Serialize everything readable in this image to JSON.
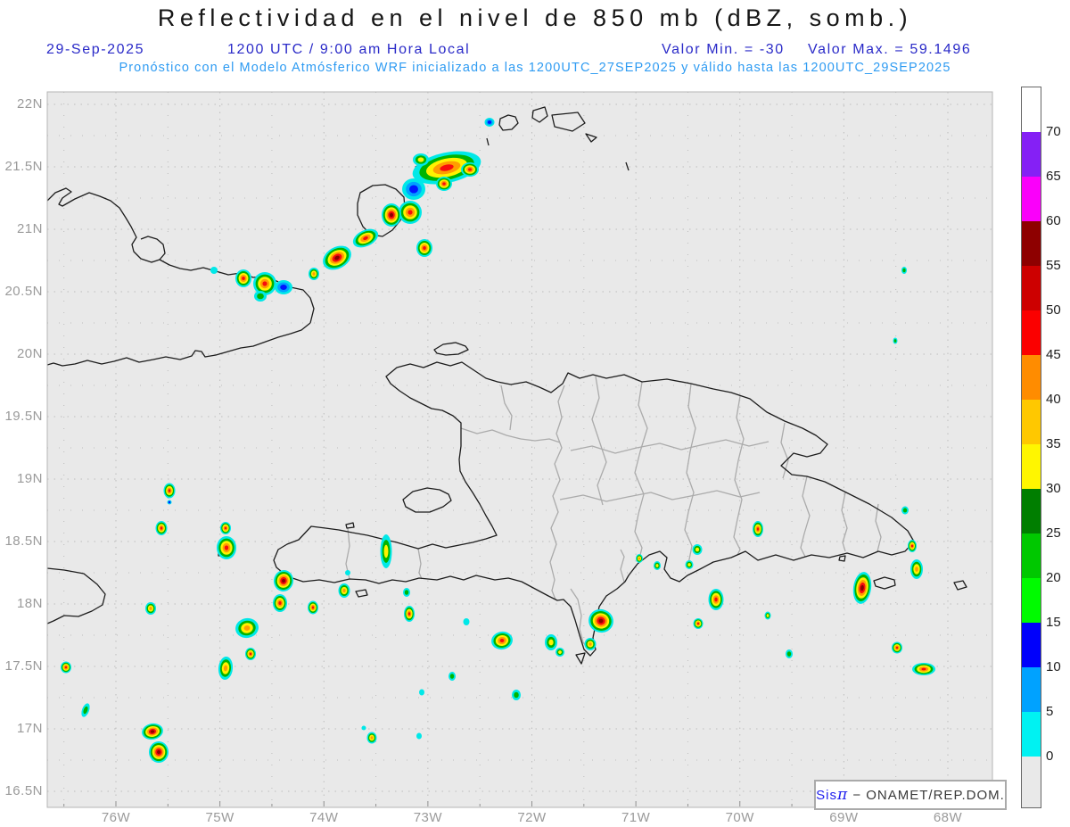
{
  "header": {
    "title": "Reflectividad en el nivel de 850 mb (dBZ, somb.)",
    "date": "29-Sep-2025",
    "time_line": "1200 UTC / 9:00 am Hora Local",
    "valor_min": "Valor Min. = -30",
    "valor_max": "Valor Max. = 59.1496",
    "forecast_line": "Pronóstico con el Modelo Atmósferico WRF inicializado a las 1200UTC_27SEP2025 y válido hasta las 1200UTC_29SEP2025"
  },
  "branding": {
    "prefix": "Sis",
    "pi": "π",
    "suffix": " − ONAMET/REP.DOM."
  },
  "axes": {
    "lat_labels": [
      "22N",
      "21.5N",
      "21N",
      "20.5N",
      "20N",
      "19.5N",
      "19N",
      "18.5N",
      "18N",
      "17.5N",
      "17N",
      "16.5N"
    ],
    "lon_labels": [
      "76W",
      "75W",
      "74W",
      "73W",
      "72W",
      "71W",
      "70W",
      "69W",
      "68W"
    ]
  },
  "colorbar": {
    "tick_labels": [
      "70",
      "65",
      "60",
      "55",
      "50",
      "45",
      "40",
      "35",
      "30",
      "25",
      "20",
      "15",
      "10",
      "5",
      "0"
    ],
    "segment_colors_top_to_bottom": [
      "#ffffff",
      "#8520f5",
      "#fa00fa",
      "#8e0000",
      "#cd0000",
      "#fb0000",
      "#ff8c00",
      "#ffc800",
      "#fff600",
      "#007e00",
      "#00c800",
      "#00fb00",
      "#0000fb",
      "#00a2ff",
      "#00f2f2",
      "#e9e9e9"
    ]
  },
  "colors": {
    "plot_bg": "#e9e9e9",
    "grid": "#bdbdbd",
    "coast": "#1c1c1c",
    "province": "#ababab",
    "header_blue": "#2a2ac8",
    "forecast_blue": "#2e9bf2",
    "axis_gray": "#9a9a9a"
  },
  "chart_data": {
    "type": "heatmap",
    "subtype": "geographic-reflectivity-map",
    "title": "Reflectividad en el nivel de 850 mb (dBZ, somb.)",
    "units": "dBZ",
    "level": "850 mb",
    "value_min": -30,
    "value_max": 59.1496,
    "model": "WRF",
    "init_time": "1200UTC_27SEP2025",
    "valid_time": "1200UTC_29SEP2025",
    "display_date": "29-Sep-2025",
    "display_time": "1200 UTC / 9:00 am Hora Local",
    "lon_axis_deg_west": [
      76,
      75,
      74,
      73,
      72,
      71,
      70,
      69,
      68
    ],
    "lat_axis_deg_north": [
      22,
      21.5,
      21,
      20.5,
      20,
      19.5,
      19,
      18.5,
      18,
      17.5,
      17,
      16.5
    ],
    "colorbar_levels": [
      0,
      5,
      10,
      15,
      20,
      25,
      30,
      35,
      40,
      45,
      50,
      55,
      60,
      65,
      70
    ],
    "legend_position": "right",
    "grid_on": true,
    "cells_note": "x,y in plot pixels (53-1113 maps 76.66W-67.57W; 103-905 maps 22.1N-16.36N); dbz = peak reflectivity of cell",
    "cells": {
      "fields": [
        "x",
        "y",
        "w",
        "h",
        "rot",
        "dbz"
      ],
      "points": [
        [
          501,
          188,
          78,
          34,
          -12,
          50
        ],
        [
          527,
          190,
          20,
          16,
          0,
          48
        ],
        [
          472,
          179,
          18,
          14,
          0,
          34
        ],
        [
          464,
          212,
          26,
          24,
          0,
          14
        ],
        [
          460,
          238,
          26,
          26,
          0,
          48
        ],
        [
          439,
          241,
          22,
          26,
          0,
          56
        ],
        [
          498,
          206,
          18,
          16,
          0,
          47
        ],
        [
          476,
          278,
          18,
          20,
          0,
          47
        ],
        [
          410,
          267,
          30,
          18,
          -25,
          48
        ],
        [
          378,
          289,
          34,
          24,
          -30,
          56
        ],
        [
          352,
          307,
          12,
          14,
          0,
          42
        ],
        [
          297,
          318,
          26,
          26,
          0,
          48
        ],
        [
          273,
          312,
          18,
          20,
          0,
          47
        ],
        [
          318,
          322,
          20,
          16,
          0,
          13
        ],
        [
          292,
          332,
          14,
          12,
          0,
          22
        ],
        [
          240,
          303,
          8,
          8,
          0,
          5
        ],
        [
          549,
          137,
          11,
          10,
          0,
          13
        ],
        [
          190,
          550,
          13,
          17,
          0,
          48
        ],
        [
          190,
          563,
          5,
          5,
          0,
          12
        ],
        [
          181,
          592,
          13,
          16,
          0,
          47
        ],
        [
          253,
          592,
          12,
          14,
          0,
          47
        ],
        [
          254,
          614,
          22,
          26,
          0,
          49
        ],
        [
          169,
          682,
          12,
          14,
          0,
          42
        ],
        [
          318,
          651,
          22,
          24,
          10,
          56
        ],
        [
          314,
          676,
          16,
          20,
          0,
          48
        ],
        [
          351,
          681,
          12,
          15,
          0,
          47
        ],
        [
          277,
          704,
          26,
          22,
          -10,
          42
        ],
        [
          281,
          733,
          12,
          14,
          0,
          48
        ],
        [
          253,
          749,
          16,
          26,
          5,
          43
        ],
        [
          74,
          748,
          12,
          13,
          0,
          47
        ],
        [
          96,
          796,
          8,
          16,
          20,
          22
        ],
        [
          171,
          820,
          24,
          18,
          -10,
          55
        ],
        [
          178,
          843,
          22,
          24,
          0,
          56
        ],
        [
          433,
          618,
          13,
          38,
          0,
          35
        ],
        [
          386,
          662,
          13,
          16,
          0,
          42
        ],
        [
          456,
          664,
          8,
          10,
          0,
          22
        ],
        [
          459,
          688,
          12,
          18,
          0,
          47
        ],
        [
          390,
          642,
          6,
          6,
          0,
          5
        ],
        [
          417,
          827,
          11,
          13,
          0,
          42
        ],
        [
          408,
          816,
          5,
          5,
          0,
          5
        ],
        [
          470,
          825,
          6,
          7,
          0,
          6
        ],
        [
          473,
          776,
          6,
          7,
          0,
          6
        ],
        [
          507,
          758,
          8,
          10,
          0,
          22
        ],
        [
          523,
          697,
          7,
          8,
          0,
          6
        ],
        [
          563,
          718,
          24,
          20,
          -10,
          49
        ],
        [
          618,
          720,
          14,
          18,
          0,
          35
        ],
        [
          628,
          731,
          10,
          10,
          40,
          34
        ],
        [
          579,
          779,
          10,
          12,
          0,
          22
        ],
        [
          674,
          696,
          28,
          26,
          15,
          56
        ],
        [
          662,
          722,
          13,
          14,
          0,
          42
        ],
        [
          717,
          626,
          8,
          10,
          0,
          41
        ],
        [
          737,
          634,
          8,
          10,
          0,
          34
        ],
        [
          782,
          616,
          11,
          12,
          0,
          35
        ],
        [
          773,
          633,
          9,
          10,
          0,
          34
        ],
        [
          803,
          672,
          17,
          24,
          0,
          48
        ],
        [
          783,
          699,
          11,
          12,
          0,
          47
        ],
        [
          850,
          593,
          12,
          18,
          0,
          48
        ],
        [
          861,
          690,
          7,
          9,
          0,
          34
        ],
        [
          885,
          733,
          8,
          10,
          0,
          22
        ],
        [
          967,
          659,
          20,
          36,
          8,
          55
        ],
        [
          1006,
          726,
          12,
          13,
          0,
          47
        ],
        [
          1036,
          750,
          26,
          14,
          0,
          48
        ],
        [
          1015,
          572,
          8,
          9,
          0,
          22
        ],
        [
          1023,
          612,
          10,
          14,
          0,
          47
        ],
        [
          1028,
          638,
          14,
          22,
          0,
          42
        ],
        [
          1014,
          303,
          6,
          8,
          0,
          20
        ],
        [
          1004,
          382,
          5,
          7,
          0,
          20
        ]
      ]
    },
    "geo": {
      "coastlines": [
        "M 53 225 L 62 216 L 74 211 L 80 215 L 70 222 L 66 229 L 70 231 L 84 223 L 100 216 L 112 220 L 124 225 L 134 233 L 141 244 L 147 254 L 153 266 L 148 274 L 150 282 L 158 290 L 170 294 L 179 291 L 185 284 L 183 274 L 176 268 L 166 265 L 158 268 M 179 291 L 190 297 L 202 301 L 214 303 L 228 300 L 242 304 L 256 308 L 270 306 L 284 311 L 298 309 L 312 316 L 326 322 L 340 325 L 348 334 L 352 346 L 348 362",
        "M 348 362 L 338 370 L 326 374 L 312 378 L 298 383 L 284 388 L 270 390 L 256 394 L 242 398 L 230 400 L 226 394 L 219 393 L 215 399 L 202 403 L 186 400 L 172 403 L 156 406 L 142 401 L 128 405 L 114 408 L 98 404 L 84 408 L 70 410 L 60 407 L 53 409",
        "M 53 637 L 72 639 L 94 643 L 109 655 L 118 666 L 115 678 L 103 685 L 88 691 L 72 690 L 60 696 L 53 699",
        "M 433 422 L 445 412 L 460 408 L 475 412 L 490 406 L 505 410 L 518 406 L 530 414 L 545 424 L 558 428 L 573 431 L 590 428 L 605 434 L 618 440 L 631 430 L 637 418 L 650 424 L 665 420 L 680 424 L 700 420 L 720 428 L 748 425 L 775 430 L 800 436 L 820 440 L 841 447 L 860 462 L 880 472 L 900 480 L 915 488 L 928 498 L 920 508 L 905 512 L 890 508 L 876 522 L 888 532 L 905 534 L 925 540 L 945 550 L 975 565 L 1000 580 L 1018 595 L 1025 607 L 1015 618 L 1000 622 L 985 618 L 968 625 L 950 620 L 930 625 L 910 622 L 890 628 L 870 622 L 850 628 L 836 618 L 820 625 L 800 630 L 785 638 L 771 645 L 762 652 L 752 648 L 745 638 L 748 625 L 740 618 L 728 622 L 715 632 L 705 645 L 701 652 L 692 660 L 680 668 L 672 680 L 668 700 L 665 715 L 668 728 L 662 735 L 655 728 L 650 712 L 645 695 L 640 680 L 632 672 L 625 673 L 615 668 L 600 660 L 585 652 L 570 648 L 555 650 L 534 645 L 520 650 L 505 646 L 490 650 L 470 648 L 455 652 L 440 650 L 425 654 L 410 650 L 392 649 L 375 653 L 358 650 L 340 652 L 322 646 L 310 636 L 307 628 L 312 616 L 322 610 L 335 605 L 349 590 L 365 592 L 380 594 L 395 597 L 412 600 L 428 604 L 445 608 L 462 613 L 469 615 L 485 610 L 500 614 L 515 611 L 530 608 L 545 604 L 557 600 L 552 590 L 545 578 L 538 565 L 530 552 L 522 540 L 516 528 L 515 515 L 517 500 L 517 486 L 517 474 L 508 466 L 496 460 L 484 458 L 472 452 L 460 446 L 448 438 L 438 430 Z"
      ],
      "islands": [
        "M 404 216 L 418 208 L 432 207 L 444 212 L 453 221 L 454 233 L 449 247 L 440 258 L 429 265 L 416 263 L 407 254 L 401 241 L 401 228 Z",
        "M 466 187 L 474 182 L 482 184 L 484 191 L 477 197 L 468 195 Z",
        "M 561 133 L 570 129 L 578 131 L 581 138 L 574 145 L 564 146 L 560 140 Z",
        "M 598 124 L 611 120 L 614 130 L 605 137 L 597 132 Z",
        "M 619 129 L 648 126 L 656 138 L 642 147 L 622 142 Z",
        "M 657 150 L 669 154 L 663 159 Z",
        "M 702 182 L 705 191",
        "M 546 155 L 548 163",
        "M 487 392 L 497 386 L 511 384 L 522 388 L 525 392 L 514 397 L 500 398 L 490 396 Z",
        "M 452 560 L 463 551 L 479 547 L 493 549 L 503 554 L 506 561 L 497 568 L 482 574 L 466 574 L 455 568 Z",
        "M 399 663 L 410 661 L 412 667 L 402 669 Z",
        "M 388 588 L 396 586 L 397 591 L 389 592 Z",
        "M 646 734 L 656 732 L 652 744 Z",
        "M 980 651 L 992 647 L 1003 650 L 1004 656 L 992 660 L 982 657 Z",
        "M 942 624 L 948 623 L 947 629 L 941 628 Z",
        "M 1070 653 L 1080 651 L 1084 658 L 1074 661 Z",
        "M 245 620 L 249 620 L 249 623 L 245 623 Z"
      ],
      "borders": [
        "M 633 432 L 626 450 L 630 468 L 624 486 L 630 502 L 622 520 L 628 538 L 620 556 L 626 574 L 618 592 L 624 610 L 617 630 L 622 650 L 619 662 L 623 672",
        "M 517 480 L 535 486 L 552 482 L 568 488 L 584 492 L 600 494 L 616 492 L 628 496",
        "M 469 615 L 472 632 L 470 642 L 473 649",
        "M 390 592 L 392 612 L 388 632 L 392 649",
        "M 562 432 L 566 452 L 574 466 L 572 482",
        "M 668 422 L 672 446 L 664 470 L 672 494 L 680 518 L 670 544 L 676 566",
        "M 720 428 L 716 454 L 726 480 L 718 506 L 712 530 L 722 554 L 716 576 L 712 596 L 720 614 L 716 630",
        "M 775 430 L 772 456 L 780 480 L 774 506 L 770 530 L 778 552 L 772 574 L 768 594 L 776 612 L 772 632",
        "M 830 444 L 826 468 L 834 492 L 828 516 L 824 538 L 832 560 L 827 582 L 823 602 L 830 616 L 827 622",
        "M 880 474 L 876 496 L 884 516 L 878 536",
        "M 905 534 L 900 556 L 908 578 L 902 598 L 898 614 L 903 624",
        "M 948 552 L 944 572 L 950 592 L 945 608 L 948 618",
        "M 640 505 L 664 500 L 690 508 L 714 502 L 740 497 L 764 504 L 790 498 L 814 493 L 840 500 L 862 495",
        "M 628 560 L 654 555 L 680 562 L 704 557 L 730 552 L 754 560 L 780 555 L 804 550 L 830 557 L 852 552",
        "M 985 565 L 982 584 L 988 602 L 984 618",
        "M 640 660 L 648 672 L 652 690 L 650 705 L 654 720 L 660 728",
        "M 700 652 L 696 638 L 700 624 L 696 616"
      ]
    }
  }
}
